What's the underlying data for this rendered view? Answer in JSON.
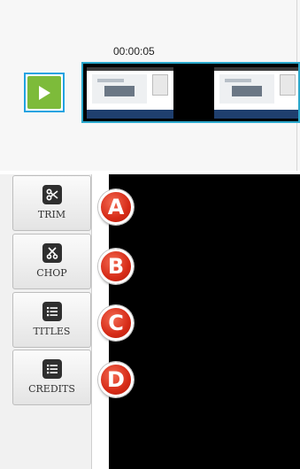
{
  "timeline": {
    "timecode": "00:00:05"
  },
  "tools": [
    {
      "label": "TRIM",
      "icon": "scissors-icon"
    },
    {
      "label": "CHOP",
      "icon": "chop-icon"
    },
    {
      "label": "TITLES",
      "icon": "list-icon"
    },
    {
      "label": "CREDITS",
      "icon": "list-icon"
    }
  ],
  "badges": [
    "A",
    "B",
    "C",
    "D"
  ],
  "colors": {
    "accent_blue": "#22a3e1",
    "play_green": "#7dbb3a",
    "badge_red": "#d62b17",
    "stage_black": "#000000"
  }
}
